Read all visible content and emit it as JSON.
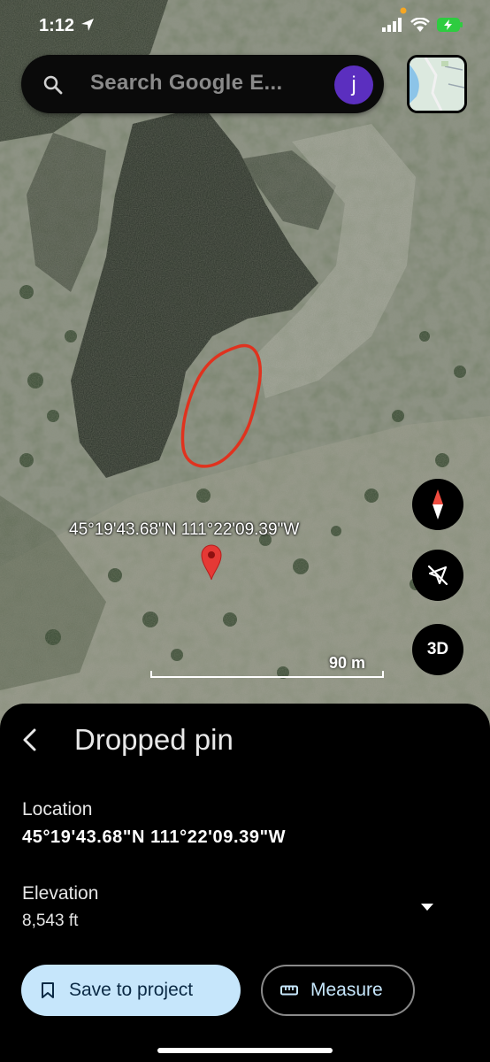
{
  "status_bar": {
    "time": "1:12"
  },
  "search": {
    "placeholder": "Search Google E...",
    "avatar_letter": "j"
  },
  "map": {
    "pin_coordinates": "45°19'43.68\"N 111°22'09.39\"W",
    "scale_label": "90 m",
    "fab_3d_label": "3D"
  },
  "sheet": {
    "title": "Dropped pin",
    "location_label": "Location",
    "location_value": "45°19'43.68\"N 111°22'09.39\"W",
    "elevation_label": "Elevation",
    "elevation_value": "8,543 ft",
    "save_button": "Save to project",
    "measure_button": "Measure"
  },
  "colors": {
    "avatar": "#5b2fbf",
    "save_button_bg": "#c6e6fb",
    "pin": "#e53935",
    "annotation": "#e0321e"
  }
}
